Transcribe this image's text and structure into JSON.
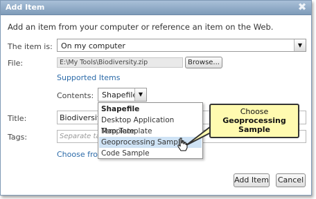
{
  "dialog": {
    "title": "Add Item",
    "close_icon": "close-x-icon"
  },
  "intro_text": "Add an item from your computer or reference an item on the Web.",
  "source": {
    "label": "The item is:",
    "selected": "On my computer"
  },
  "file": {
    "label": "File:",
    "value": "E:\\My Tools\\Biodiversity.zip",
    "browse_label": "Browse...",
    "supported_link": "Supported Items"
  },
  "contents": {
    "label": "Contents:",
    "selected": "Shapefile",
    "options": [
      "Shapefile",
      "Desktop Application Template",
      "Map Template",
      "Geoprocessing Sample",
      "Code Sample"
    ]
  },
  "title_field": {
    "label": "Title:",
    "value": "Biodiversity"
  },
  "tags_field": {
    "label": "Tags:",
    "placeholder": "Separate tags",
    "choose_link": "Choose from"
  },
  "buttons": {
    "add_item": "Add Item",
    "cancel": "Cancel"
  },
  "callout": {
    "line1": "Choose",
    "line2": "Geoprocessing",
    "line3": "Sample"
  },
  "colors": {
    "titlebar": "#8fa9c5",
    "link": "#2b6aa8",
    "highlight": "#cfe3f5",
    "callout_bg": "#fffab0"
  }
}
